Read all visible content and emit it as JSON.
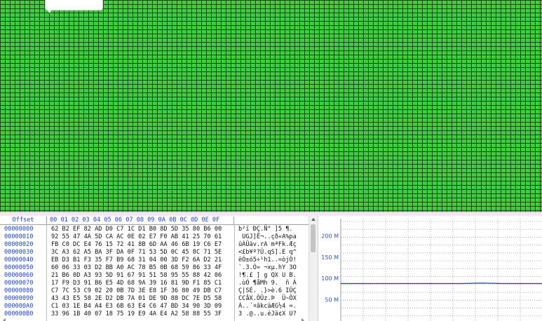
{
  "block_map": {
    "fill_color": "#3fcb3f",
    "grid_color": "#0e4f0e"
  },
  "hex_view": {
    "header_offset": "Offset",
    "header_hex": "00 01 02 03 04 05 06 07 08 09 0A 0B 0C 0D 0E 0F",
    "rows": [
      {
        "offset": "00000000",
        "hex": "62 B2 EF 82 AD D0 C7 1C D1 B0 8D 5D 35 80 B6 00",
        "ascii": "b²ï ­ÐÇ.Ñ° ]5 ¶."
      },
      {
        "offset": "00000010",
        "hex": "92 55 47 4A 5D CA AC 0E 02 E7 F0 AB 41 25 70 61",
        "ascii": " UGJ]Ê¬..çð«A%pa"
      },
      {
        "offset": "00000020",
        "hex": "FB C0 DC E4 76 15 72 41 8B 6D AA 46 6B 19 C6 E7",
        "ascii": "ûÀÜäv.rA mªFk.Æç"
      },
      {
        "offset": "00000030",
        "hex": "3C A3 62 A5 BA 3F DA 0F 71 53 5D 0C 45 8C 71 5E",
        "ascii": "<£b¥º?Ú.qS].E q^"
      },
      {
        "offset": "00000040",
        "hex": "EB D3 B1 F3 35 F7 B9 68 31 04 00 3D F2 6A D2 21",
        "ascii": "ëÓ±ó5÷¹h1..=òjÒ!"
      },
      {
        "offset": "00000050",
        "hex": "60 06 33 03 D2 BB A0 AC 78 B5 0B 68 59 86 33 4F",
        "ascii": "`.3.Ò» ¬xµ.hY 3O"
      },
      {
        "offset": "00000060",
        "hex": "21 B6 0D A3 93 5D 91 67 91 51 58 95 55 88 42 06",
        "ascii": "!¶.£ ] g QX U B."
      },
      {
        "offset": "00000070",
        "hex": "17 F9 D3 91 B6 E5 4D 68 9A 39 16 81 9D F1 85 C1",
        "ascii": ".ùÓ ¶åMh 9.  ñ Á"
      },
      {
        "offset": "00000080",
        "hex": "C7 7C 53 C9 02 20 0B 7D 3E E8 1F 36 80 49 DB C7",
        "ascii": "Ç|SÉ. .}>è.6 IÛÇ"
      },
      {
        "offset": "00000090",
        "hex": "43 43 E5 58 2E D2 DB 7A 01 DE 9D 88 DC 7E D5 58",
        "ascii": "CCåX.ÒÛz.Þ  Ü~ÕX"
      },
      {
        "offset": "000000A0",
        "hex": "C1 03 1E B4 A4 E3 6B 63 E4 C6 47 BD 34 90 3D 09",
        "ascii": "Á..´¤ãkcäÆG½4 =."
      },
      {
        "offset": "000000B0",
        "hex": "33 96 1B 40 07 18 75 19 E9 4A E4 A2 58 88 55 3F",
        "ascii": "3 .@..u.éJä¢X U?"
      }
    ]
  },
  "chart": {
    "line_color": "#1f3fbf",
    "grid_color": "#9a9a9a"
  },
  "chart_data": {
    "type": "line",
    "y_tick_labels": [
      "200 M",
      "150 M",
      "100 M",
      "50 M"
    ],
    "y_ticks": [
      200,
      150,
      100,
      50
    ],
    "ylim": [
      0,
      240
    ],
    "xlim": [
      0,
      100
    ],
    "series": [
      {
        "x": [
          0,
          20,
          40,
          60,
          70,
          80,
          100
        ],
        "values": [
          88,
          88,
          88,
          88,
          89,
          88,
          88
        ]
      }
    ]
  }
}
